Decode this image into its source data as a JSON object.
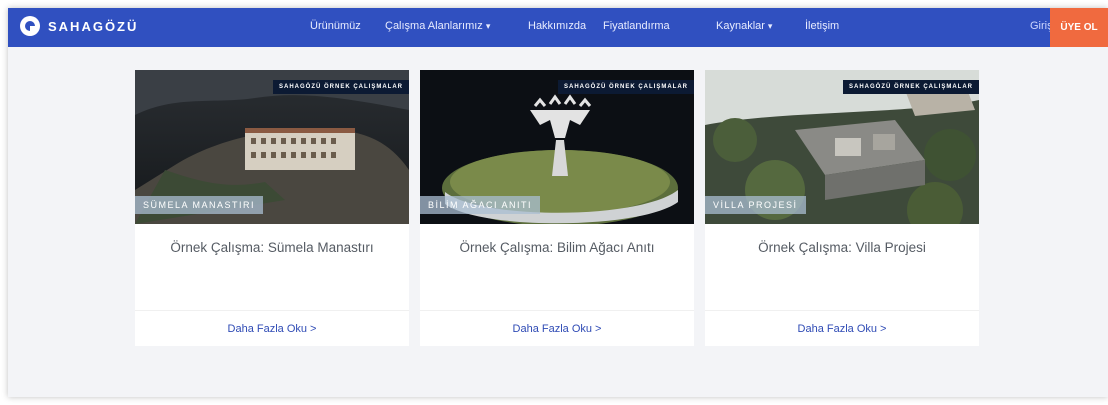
{
  "brand": {
    "name": "SAHAGÖZÜ"
  },
  "nav": {
    "items": [
      {
        "label": "Ürünümüz",
        "dropdown": false
      },
      {
        "label": "Çalışma Alanlarımız",
        "dropdown": true
      },
      {
        "label": "Hakkımızda",
        "dropdown": false
      },
      {
        "label": "Fiyatlandırma",
        "dropdown": false
      },
      {
        "label": "Kaynaklar",
        "dropdown": true
      },
      {
        "label": "İletişim",
        "dropdown": false
      }
    ],
    "login_label": "Giriş",
    "signup_label": "ÜYE OL"
  },
  "cards": [
    {
      "badge": "SAHAGÖZÜ ÖRNEK ÇALIŞMALAR",
      "image_label": "SÜMELA MANASTIRI",
      "title": "Örnek Çalışma: Sümela Manastırı",
      "link": "Daha Fazla Oku >"
    },
    {
      "badge": "SAHAGÖZÜ ÖRNEK ÇALIŞMALAR",
      "image_label": "BİLİM AĞACI ANITI",
      "title": "Örnek Çalışma: Bilim Ağacı Anıtı",
      "link": "Daha Fazla Oku >"
    },
    {
      "badge": "SAHAGÖZÜ ÖRNEK ÇALIŞMALAR",
      "image_label": "VİLLA PROJESİ",
      "title": "Örnek Çalışma: Villa Projesi",
      "link": "Daha Fazla Oku >"
    }
  ],
  "colors": {
    "nav": "#3050c0",
    "cta": "#f06a3f",
    "link": "#2f4bb5"
  }
}
